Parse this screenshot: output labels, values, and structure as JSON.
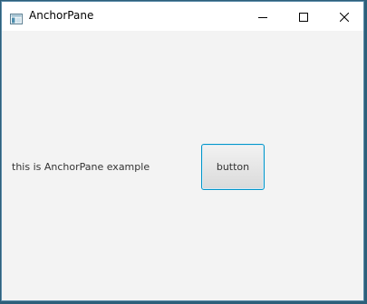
{
  "window": {
    "title": "AnchorPane",
    "icons": {
      "app": "java-app-icon",
      "minimize": "minimize-icon",
      "maximize": "maximize-icon",
      "close": "close-icon"
    }
  },
  "content": {
    "label_text": "this is AnchorPane example",
    "button_label": "button"
  },
  "colors": {
    "focus_border": "#0096c9",
    "background": "#f3f3f3",
    "titlebar": "#ffffff"
  }
}
